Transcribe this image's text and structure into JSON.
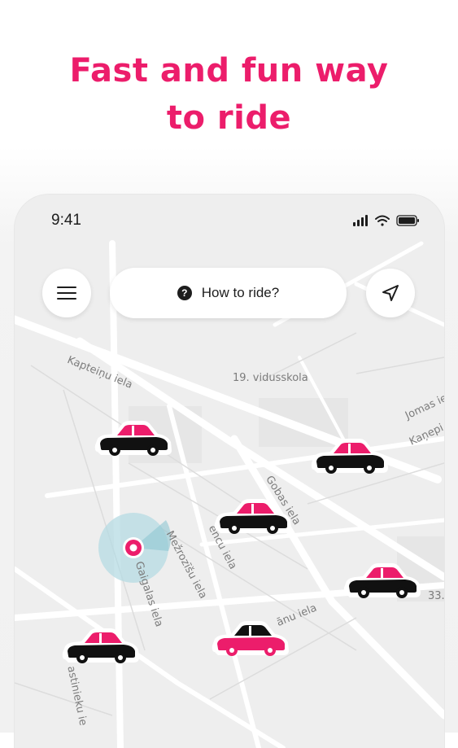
{
  "headline": {
    "line1": "Fast and fun way",
    "line2": "to ride"
  },
  "status_bar": {
    "time": "9:41",
    "icons": [
      "signal-icon",
      "wifi-icon",
      "battery-icon"
    ]
  },
  "top_controls": {
    "menu_icon": "hamburger-menu-icon",
    "help_icon": "question-icon",
    "how_to_ride_label": "How to ride?",
    "locate_icon": "navigation-arrow-icon"
  },
  "map_labels": {
    "kapteinu": "Kapteiņu iela",
    "vidusskola": "19. vidusskola",
    "jomas": "Jomas ie",
    "kanepi": "Kaņepi",
    "gobas": "Gobas iela",
    "mezrozisu": "Mežrozīšu iela",
    "encu": "encu iela",
    "gaigalas": "Gaigalas iela",
    "anu": "ānu iela",
    "num33": "33.",
    "astinieku": "astinieku ie"
  },
  "cars": [
    {
      "id": "car-1",
      "selected": false
    },
    {
      "id": "car-2",
      "selected": false
    },
    {
      "id": "car-3",
      "selected": false
    },
    {
      "id": "car-4",
      "selected": false
    },
    {
      "id": "car-5",
      "selected": true
    },
    {
      "id": "car-6",
      "selected": false
    }
  ],
  "colors": {
    "brand_pink": "#ec1d6b",
    "car_black": "#111111",
    "map_bg": "#eeeeee",
    "road": "#ffffff",
    "label": "#7c7c7c"
  }
}
